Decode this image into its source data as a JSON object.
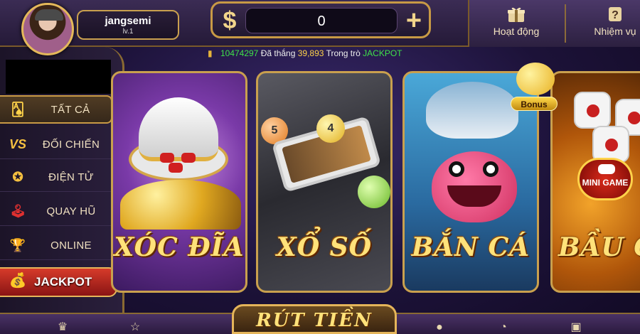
{
  "header": {
    "username": "jangsemi",
    "level": "lv.1",
    "balance": "0",
    "dollar_symbol": "$",
    "plus_symbol": "+",
    "activity_label": "Hoạt động",
    "mission_label": "Nhiệm vụ"
  },
  "ticker": {
    "amount": "10474297",
    "won_text": "Đã thắng",
    "prize": "39,893",
    "game_text": "Trong trò",
    "game_name": "JACKPOT"
  },
  "sidebar": {
    "items": [
      {
        "label": "TẤT CẢ",
        "icon": "cards-icon"
      },
      {
        "label": "ĐỐI CHIẾN",
        "icon": "vs-icon"
      },
      {
        "label": "ĐIỆN TỬ",
        "icon": "star-badge-icon"
      },
      {
        "label": "QUAY HŨ",
        "icon": "joystick-icon"
      },
      {
        "label": "ONLINE",
        "icon": "trophy-icon"
      }
    ],
    "jackpot_label": "JACKPOT"
  },
  "games": [
    {
      "title": "XÓC ĐĨA"
    },
    {
      "title": "XỔ SỐ"
    },
    {
      "title": "BẮN CÁ"
    },
    {
      "title": "BẦU CUA"
    }
  ],
  "ball_numbers": {
    "gold": "4",
    "orange": "5"
  },
  "bonus_label": "Bonus",
  "mini_game_label": "MINI GAME",
  "bottom": {
    "withdraw_label": "RÚT TIỀN"
  },
  "colors": {
    "accent_gold": "#c9a04e",
    "ticker_green": "#3fe04a",
    "ticker_yellow": "#ffd34a",
    "jackpot_red": "#d63b2a"
  }
}
